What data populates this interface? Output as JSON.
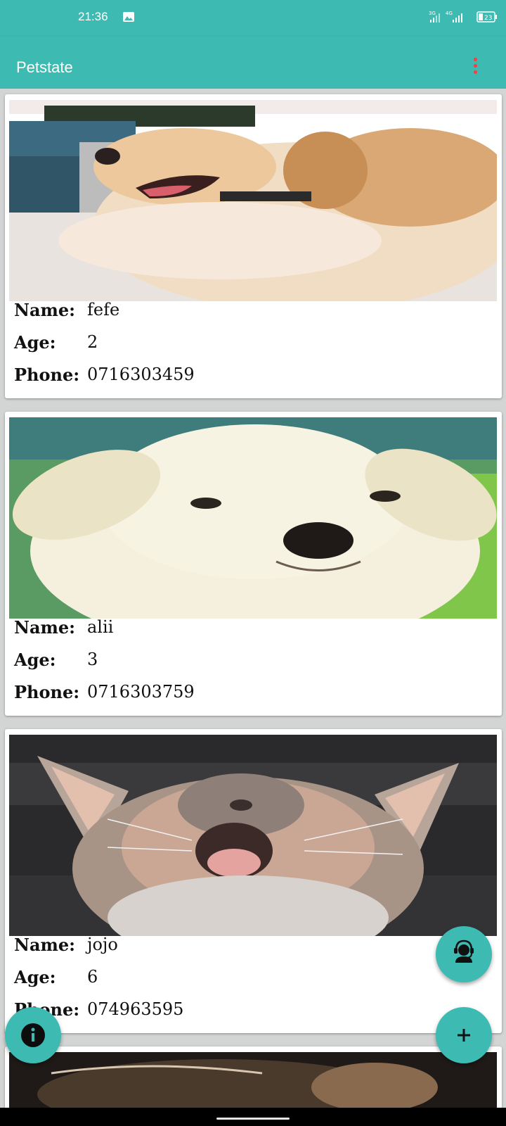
{
  "status_bar": {
    "time": "21:36",
    "network": "3G 4G",
    "battery": "23"
  },
  "app_bar": {
    "title": "Petstate",
    "overflow_icon": "more-vert-icon"
  },
  "pets": [
    {
      "name_label": "Name:",
      "name": "fefe",
      "age_label": "Age:",
      "age": "2",
      "phone_label": "Phone:",
      "phone": "0716303459",
      "photo": "golden-puppy-on-boat"
    },
    {
      "name_label": "Name:",
      "name": "alii",
      "age_label": "Age:",
      "age": "3",
      "phone_label": "Phone:",
      "phone": "0716303759",
      "photo": "white-puppy-on-grass"
    },
    {
      "name_label": "Name:",
      "name": "jojo",
      "age_label": "Age:",
      "age": "6",
      "phone_label": "Phone:",
      "phone": "074963595",
      "photo": "yawning-kitten"
    }
  ],
  "fabs": {
    "info_icon": "info-icon",
    "support_icon": "support-agent-icon",
    "add_icon": "add-icon"
  },
  "colors": {
    "primary": "#3dbbb2",
    "accent_overflow": "#ff3b3b"
  }
}
